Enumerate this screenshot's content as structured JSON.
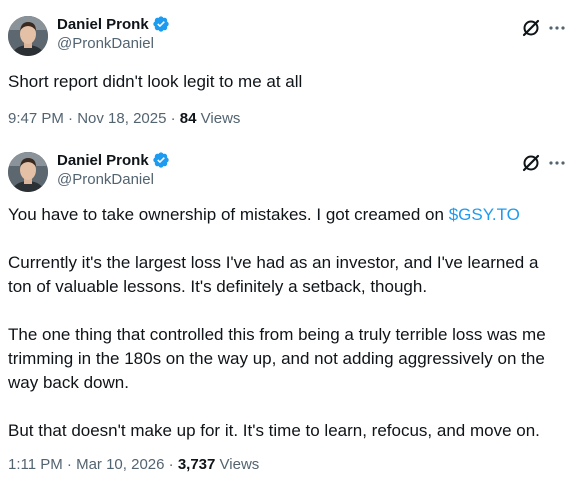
{
  "tweets": [
    {
      "author": {
        "name": "Daniel Pronk",
        "handle": "@PronkDaniel"
      },
      "text": "Short report didn't look legit to me at all",
      "time": "9:47 PM",
      "date": "Nov 18, 2025",
      "views_count": "84",
      "views_label": "Views"
    },
    {
      "author": {
        "name": "Daniel Pronk",
        "handle": "@PronkDaniel"
      },
      "paragraph1_prefix": "You have to take ownership of mistakes. I got creamed on ",
      "cashtag": "$GSY.TO",
      "paragraph2": "Currently it's the largest loss I've had as an investor, and I've learned a ton of valuable lessons. It's definitely a setback, though.",
      "paragraph3": "The one thing that controlled this from being a truly terrible loss was me trimming in the 180s on the way up, and not adding aggressively on the way back down.",
      "paragraph4": "But that doesn't make up for it. It's time to learn, refocus, and move on.",
      "time": "1:11 PM",
      "date": "Mar 10, 2026",
      "views_count": "3,737",
      "views_label": "Views"
    }
  ],
  "separator": "·",
  "icons": {
    "verified": "verified-badge-icon",
    "grok": "grok-icon",
    "more": "more-icon"
  },
  "colors": {
    "verified": "#1d9bf0",
    "link": "#1d9bf0",
    "secondary_text": "#536471",
    "primary_text": "#0f1419"
  }
}
